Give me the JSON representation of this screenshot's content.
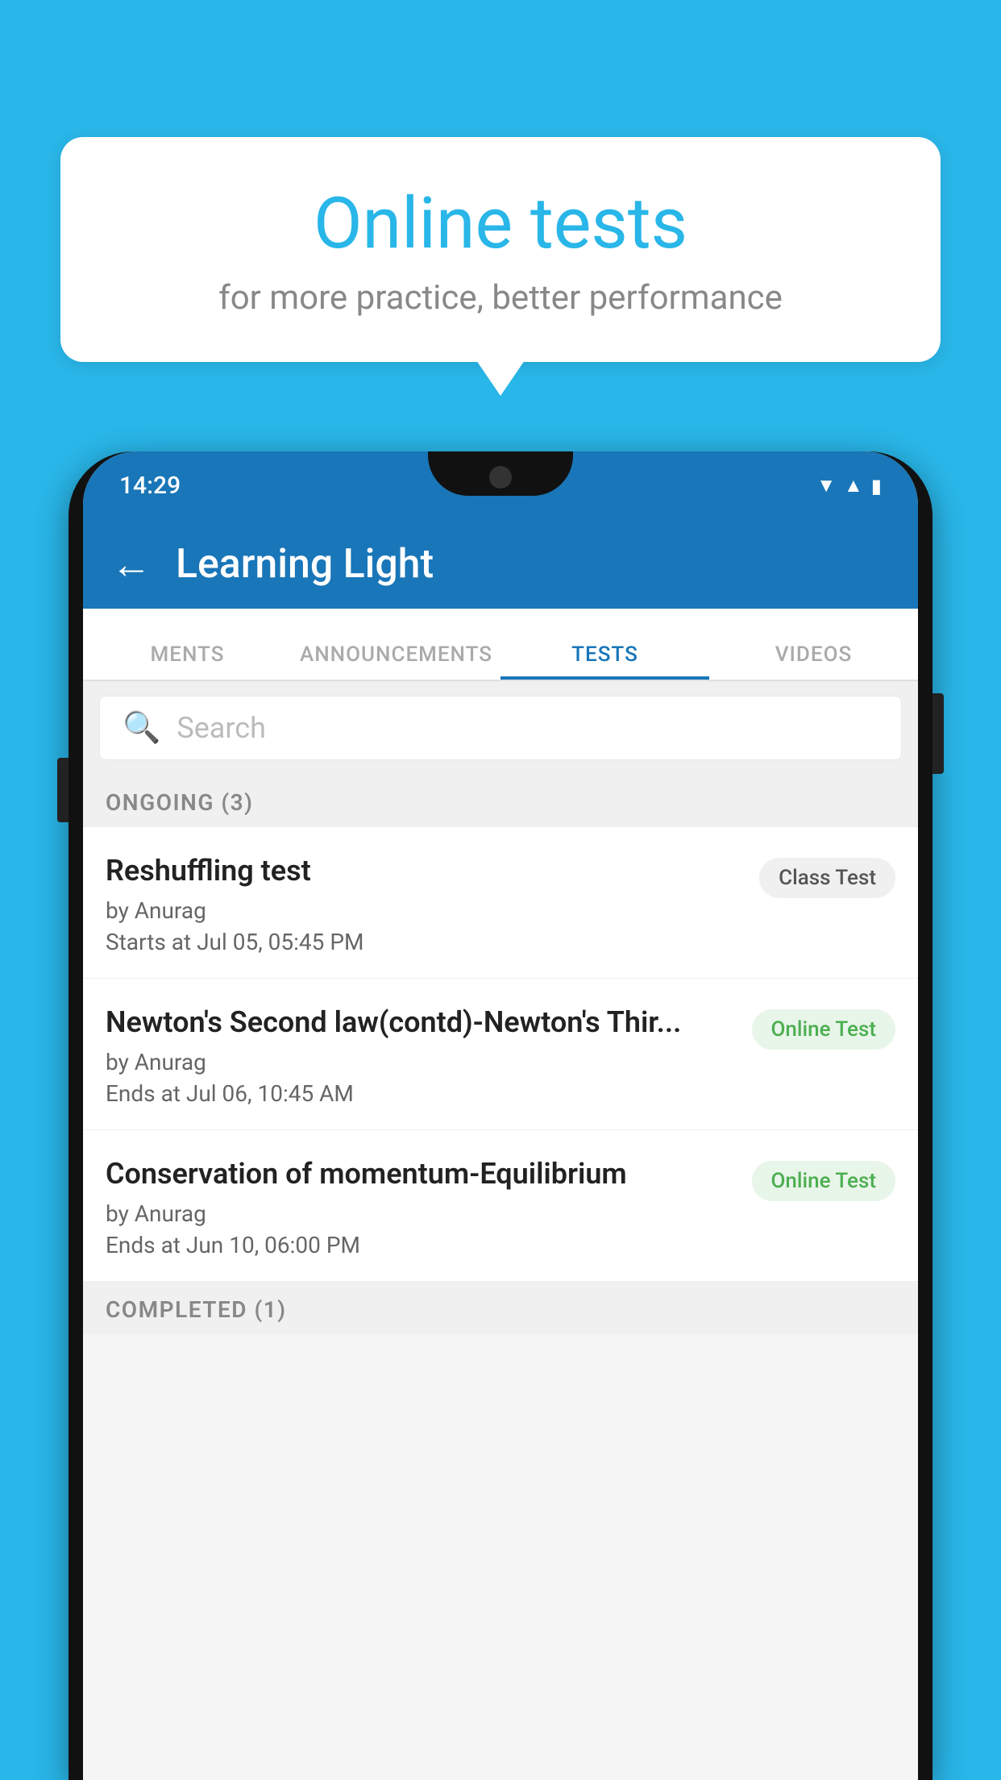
{
  "background": {
    "color": "#29b6e8"
  },
  "speech_bubble": {
    "title": "Online tests",
    "subtitle": "for more practice, better performance"
  },
  "phone": {
    "status_bar": {
      "time": "14:29",
      "icons": [
        "wifi",
        "signal",
        "battery"
      ]
    },
    "app_bar": {
      "back_label": "←",
      "title": "Learning Light"
    },
    "tabs": [
      {
        "label": "MENTS",
        "active": false
      },
      {
        "label": "ANNOUNCEMENTS",
        "active": false
      },
      {
        "label": "TESTS",
        "active": true
      },
      {
        "label": "VIDEOS",
        "active": false
      }
    ],
    "search": {
      "placeholder": "Search"
    },
    "section_ongoing": {
      "title": "ONGOING (3)"
    },
    "tests": [
      {
        "name": "Reshuffling test",
        "by": "by Anurag",
        "date_label": "Starts at",
        "date": "Jul 05, 05:45 PM",
        "badge": "Class Test",
        "badge_type": "class"
      },
      {
        "name": "Newton's Second law(contd)-Newton's Thir...",
        "by": "by Anurag",
        "date_label": "Ends at",
        "date": "Jul 06, 10:45 AM",
        "badge": "Online Test",
        "badge_type": "online"
      },
      {
        "name": "Conservation of momentum-Equilibrium",
        "by": "by Anurag",
        "date_label": "Ends at",
        "date": "Jun 10, 06:00 PM",
        "badge": "Online Test",
        "badge_type": "online"
      }
    ],
    "section_completed": {
      "title": "COMPLETED (1)"
    }
  }
}
